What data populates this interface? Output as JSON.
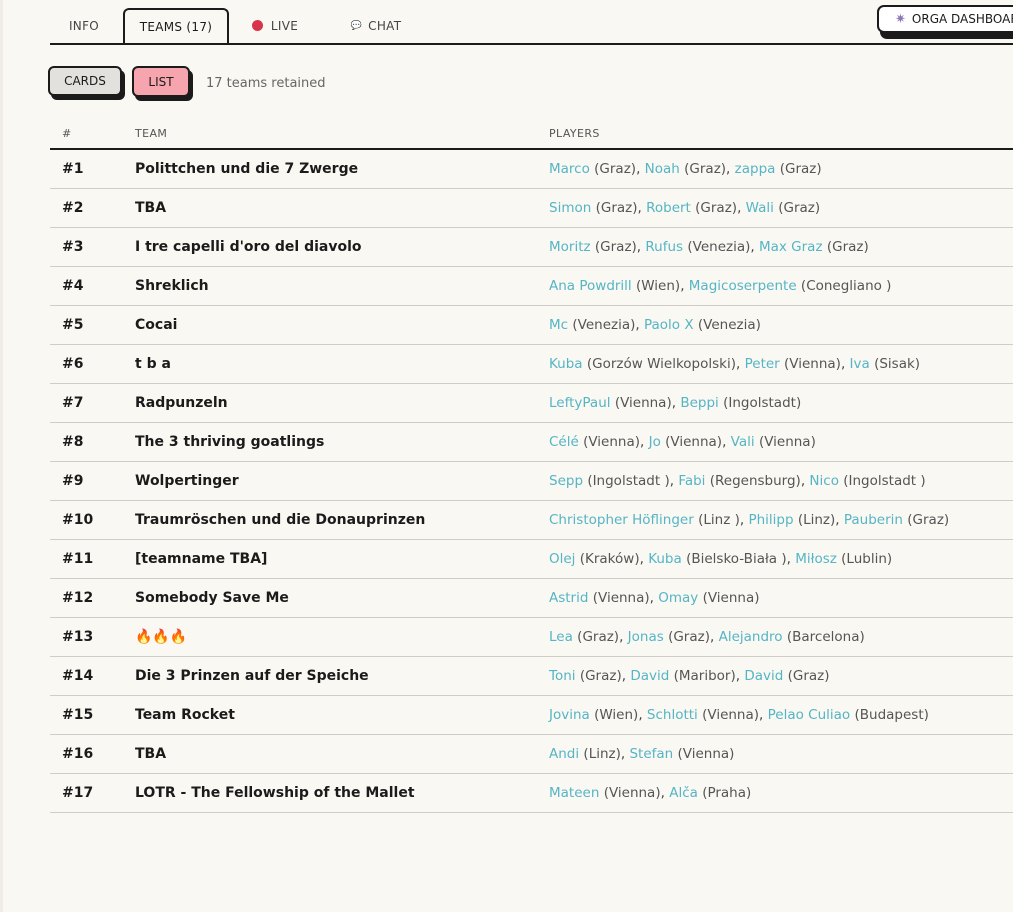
{
  "tabs": {
    "info": "INFO",
    "teams": "TEAMS (17)",
    "live": "LIVE",
    "chat": "CHAT"
  },
  "orga_button": "ORGA DASHBOARD",
  "view_toggle": {
    "cards": "CARDS",
    "list": "LIST"
  },
  "retained_text": "17 teams retained",
  "table": {
    "headers": {
      "num": "#",
      "team": "TEAM",
      "players": "PLAYERS"
    },
    "rows": [
      {
        "num": "#1",
        "team": "Polittchen und die 7 Zwerge",
        "players": [
          {
            "name": "Marco",
            "city": "(Graz)"
          },
          {
            "name": "Noah",
            "city": "(Graz)"
          },
          {
            "name": "zappa",
            "city": "(Graz)"
          }
        ]
      },
      {
        "num": "#2",
        "team": "TBA",
        "players": [
          {
            "name": "Simon",
            "city": "(Graz)"
          },
          {
            "name": "Robert",
            "city": "(Graz)"
          },
          {
            "name": "Wali",
            "city": "(Graz)"
          }
        ]
      },
      {
        "num": "#3",
        "team": "I tre capelli d'oro del diavolo",
        "players": [
          {
            "name": "Moritz",
            "city": "(Graz)"
          },
          {
            "name": "Rufus",
            "city": "(Venezia)"
          },
          {
            "name": "Max Graz",
            "city": "(Graz)"
          }
        ]
      },
      {
        "num": "#4",
        "team": "Shreklich",
        "players": [
          {
            "name": "Ana Powdrill",
            "city": "(Wien)"
          },
          {
            "name": "Magicoserpente",
            "city": "(Conegliano )"
          }
        ]
      },
      {
        "num": "#5",
        "team": "Cocai",
        "players": [
          {
            "name": "Mc",
            "city": "(Venezia)"
          },
          {
            "name": "Paolo X",
            "city": "(Venezia)"
          }
        ]
      },
      {
        "num": "#6",
        "team": "t b a",
        "players": [
          {
            "name": "Kuba",
            "city": "(Gorzów Wielkopolski)"
          },
          {
            "name": "Peter",
            "city": "(Vienna)"
          },
          {
            "name": "Iva",
            "city": "(Sisak)"
          }
        ]
      },
      {
        "num": "#7",
        "team": "Radpunzeln",
        "players": [
          {
            "name": "LeftyPaul",
            "city": "(Vienna)"
          },
          {
            "name": "Beppi",
            "city": "(Ingolstadt)"
          }
        ]
      },
      {
        "num": "#8",
        "team": "The 3 thriving goatlings",
        "players": [
          {
            "name": "Célé",
            "city": "(Vienna)"
          },
          {
            "name": "Jo",
            "city": "(Vienna)"
          },
          {
            "name": "Vali",
            "city": "(Vienna)"
          }
        ]
      },
      {
        "num": "#9",
        "team": "Wolpertinger",
        "players": [
          {
            "name": "Sepp",
            "city": "(Ingolstadt )"
          },
          {
            "name": "Fabi",
            "city": "(Regensburg)"
          },
          {
            "name": "Nico",
            "city": "(Ingolstadt )"
          }
        ]
      },
      {
        "num": "#10",
        "team": "Traumröschen und die Donauprinzen",
        "players": [
          {
            "name": "Christopher Höflinger",
            "city": "(Linz )"
          },
          {
            "name": "Philipp",
            "city": "(Linz)"
          },
          {
            "name": "Pauberin",
            "city": "(Graz)"
          }
        ]
      },
      {
        "num": "#11",
        "team": "[teamname TBA]",
        "players": [
          {
            "name": "Olej",
            "city": "(Kraków)"
          },
          {
            "name": "Kuba",
            "city": "(Bielsko-Biała )"
          },
          {
            "name": "Miłosz",
            "city": "(Lublin)"
          }
        ]
      },
      {
        "num": "#12",
        "team": "Somebody Save Me",
        "players": [
          {
            "name": "Astrid",
            "city": "(Vienna)"
          },
          {
            "name": "Omay",
            "city": "(Vienna)"
          }
        ]
      },
      {
        "num": "#13",
        "team": "🔥🔥🔥",
        "players": [
          {
            "name": "Lea",
            "city": "(Graz)"
          },
          {
            "name": "Jonas",
            "city": "(Graz)"
          },
          {
            "name": "Alejandro",
            "city": "(Barcelona)"
          }
        ]
      },
      {
        "num": "#14",
        "team": "Die 3 Prinzen auf der Speiche",
        "players": [
          {
            "name": "Toni",
            "city": "(Graz)"
          },
          {
            "name": "David",
            "city": "(Maribor)"
          },
          {
            "name": "David",
            "city": "(Graz)"
          }
        ]
      },
      {
        "num": "#15",
        "team": "Team Rocket",
        "players": [
          {
            "name": "Jovina",
            "city": "(Wien)"
          },
          {
            "name": "Schlotti",
            "city": "(Vienna)"
          },
          {
            "name": "Pelao Culiao",
            "city": "(Budapest)"
          }
        ]
      },
      {
        "num": "#16",
        "team": "TBA",
        "players": [
          {
            "name": "Andi",
            "city": "(Linz)"
          },
          {
            "name": "Stefan",
            "city": "(Vienna)"
          }
        ]
      },
      {
        "num": "#17",
        "team": "LOTR - The Fellowship of the Mallet",
        "players": [
          {
            "name": "Mateen",
            "city": "(Vienna)"
          },
          {
            "name": "Alča",
            "city": "(Praha)"
          }
        ]
      }
    ]
  },
  "colors": {
    "accent_link": "#55b5c5",
    "live_dot": "#d8334a",
    "list_active": "#f6a4ad"
  }
}
